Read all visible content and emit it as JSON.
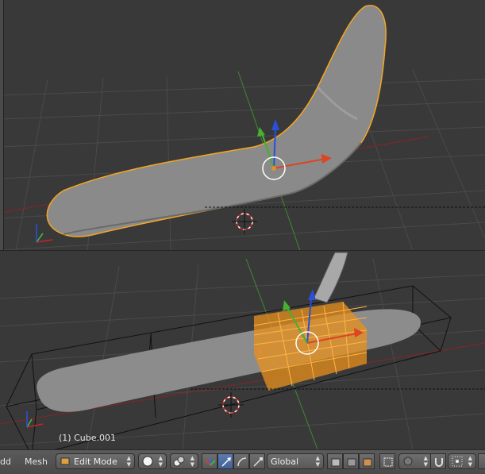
{
  "viewport_bottom": {
    "object_label": "(1) Cube.001"
  },
  "header": {
    "menu_add": "dd",
    "menu_mesh": "Mesh",
    "mode_select": {
      "value": "Edit Mode",
      "icon": "mode-icon"
    },
    "shading_select": {
      "icon": "sphere-shading-icon"
    },
    "pivot_select": {
      "icon": "pivot-icon"
    },
    "transform_orientation": {
      "value": "Global"
    },
    "manipulator_buttons": [
      "manipulator-axes-icon",
      "translate-icon",
      "rotate-icon",
      "scale-icon"
    ],
    "layer_buttons": [
      "layer-icon",
      "layer-icon",
      "layer-icon"
    ],
    "proportional_select": {
      "icon": "proportional-icon"
    },
    "snap_icon": "magnet-icon",
    "snap_target": {
      "icon": "snap-target-icon"
    }
  },
  "colors": {
    "viewport_bg": "#393939",
    "selection_orange": "#f5a623",
    "x_axis": "#c8262a",
    "y_axis": "#5cb440",
    "z_axis": "#2b4fd8"
  }
}
